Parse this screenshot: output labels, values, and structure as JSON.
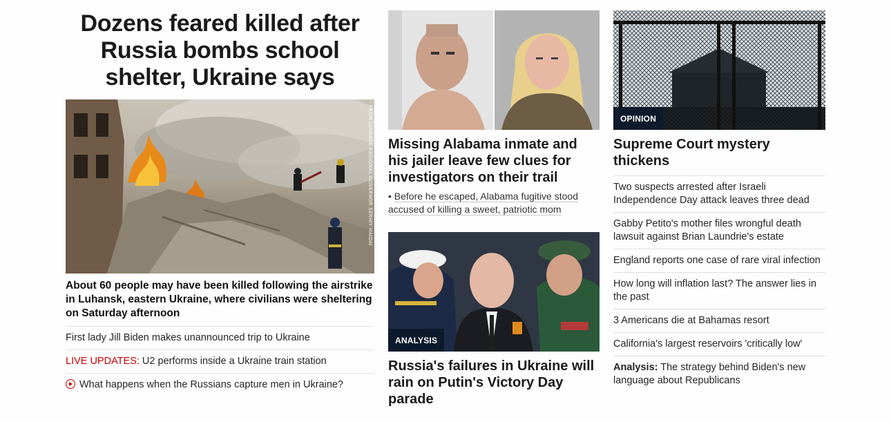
{
  "lead": {
    "headline": "Dozens feared killed after Russia bombs school shelter, Ukraine says",
    "image_credit": "FROM LUHANSK REGIONAL GOVERNOR SERHIY HAIDAI",
    "subhead": "About 60 people may have been killed following the airstrike in Luhansk, eastern Ukraine, where civilians were sheltering on Saturday afternoon",
    "links": [
      {
        "text": "First lady Jill Biden makes unannounced trip to Ukraine"
      },
      {
        "prefix": "LIVE UPDATES:",
        "text": " U2 performs inside a Ukraine train station"
      },
      {
        "text": "What happens when the Russians capture men in Ukraine?"
      }
    ]
  },
  "middle": {
    "story1": {
      "title": "Missing Alabama inmate and his jailer leave few clues for investigators on their trail",
      "bullet": "Before he escaped, Alabama fugitive stood accused of killing a sweet, patriotic mom"
    },
    "story2": {
      "tag": "ANALYSIS",
      "title": "Russia's failures in Ukraine will rain on Putin's Victory Day parade"
    }
  },
  "right": {
    "story": {
      "tag": "OPINION",
      "title": "Supreme Court mystery thickens"
    },
    "links": [
      {
        "text": "Two suspects arrested after Israeli Independence Day attack leaves three dead"
      },
      {
        "text": "Gabby Petito's mother files wrongful death lawsuit against Brian Laundrie's estate"
      },
      {
        "text": "England reports one case of rare viral infection"
      },
      {
        "text": "How long will inflation last? The answer lies in the past"
      },
      {
        "text": "3 Americans die at Bahamas resort"
      },
      {
        "text": "California's largest reservoirs 'critically low'"
      },
      {
        "prefix": "Analysis:",
        "text": " The strategy behind Biden's new language about Republicans"
      }
    ]
  },
  "colors": {
    "live": "#cc0000",
    "tag_bg": "#0d1a2b"
  }
}
